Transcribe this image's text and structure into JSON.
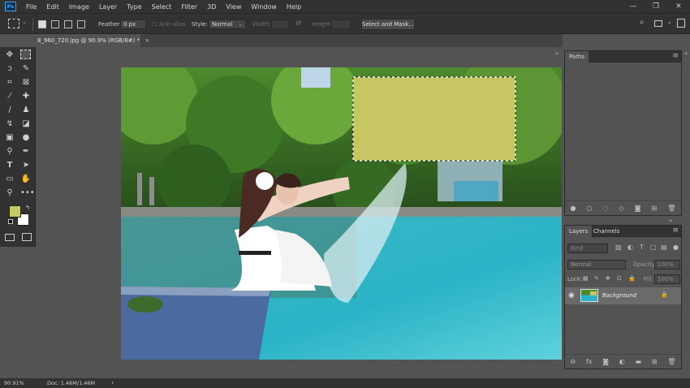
{
  "app": {
    "logo": "Ps"
  },
  "menu": [
    "File",
    "Edit",
    "Image",
    "Layer",
    "Type",
    "Select",
    "Filter",
    "3D",
    "View",
    "Window",
    "Help"
  ],
  "window_controls": {
    "minimize": "—",
    "maximize": "❐",
    "close": "✕"
  },
  "options_bar": {
    "feather_label": "Feather:",
    "feather_value": "0 px",
    "antialias_label": "Anti-alias",
    "style_label": "Style:",
    "style_value": "Normal",
    "width_label": "Width:",
    "height_label": "Height:",
    "select_mask_label": "Select and Mask..."
  },
  "document_tab": {
    "title": "8_960_720.jpg @ 90.9% (RGB/8#) *",
    "close": "×"
  },
  "colors": {
    "foreground": "#c6c966",
    "background": "#ffffff",
    "selection_fill": "#c6c663"
  },
  "paths_panel": {
    "tab": "Paths",
    "menu": "≡"
  },
  "layers_panel": {
    "tabs": [
      "Layers",
      "Channels"
    ],
    "search_placeholder": "Kind",
    "blend_mode": "Normal",
    "opacity_label": "Opacity:",
    "opacity_value": "100%",
    "lock_label": "Lock:",
    "fill_label": "Fill:",
    "fill_value": "100%",
    "layer_name": "Background"
  },
  "status": {
    "zoom": "90.91%",
    "doc": "Doc: 1.46M/1.46M",
    "arrow": "›"
  }
}
